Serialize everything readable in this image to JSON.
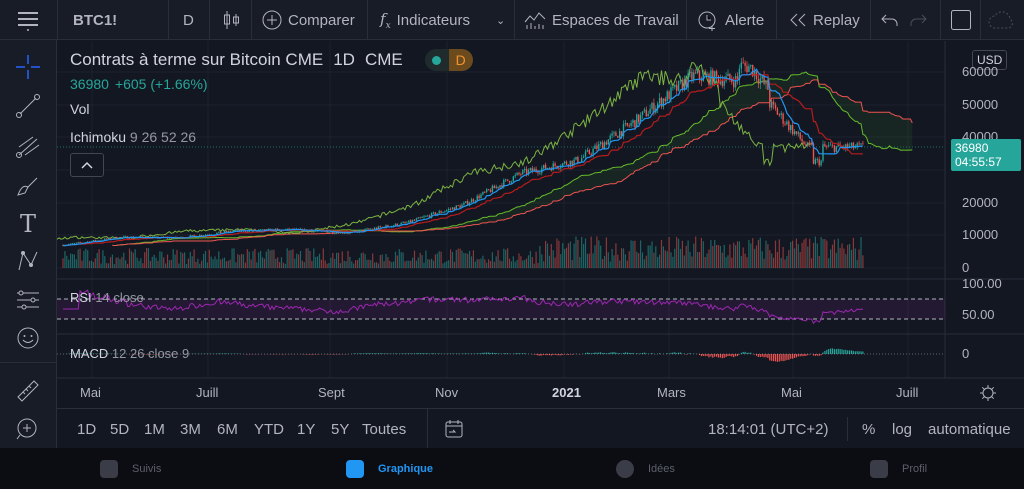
{
  "toolbar": {
    "symbol": "BTC1!",
    "interval": "D",
    "compare": "Comparer",
    "indicators": "Indicateurs",
    "workspaces": "Espaces de Travail",
    "alert": "Alerte",
    "replay": "Replay"
  },
  "legend": {
    "title": "Contrats à terme sur Bitcoin CME",
    "interval": "1D",
    "exchange": "CME",
    "badge": "D",
    "last": "36980",
    "change": "+605 (+1.66%)",
    "vol": "Vol",
    "ichimoku": "Ichimoku",
    "ichimoku_params": "9 26 52 26"
  },
  "rsi": {
    "label": "RSI",
    "params": "14 close",
    "axis": [
      "100.00",
      "50.00"
    ]
  },
  "macd": {
    "label": "MACD",
    "params": "12 26 close 9",
    "axis": [
      "0"
    ]
  },
  "price_axis": {
    "currency": "USD",
    "ticks": [
      "60000",
      "50000",
      "40000",
      "30000",
      "20000",
      "10000",
      "0"
    ],
    "last_price": "36980",
    "countdown": "04:55:57"
  },
  "time_axis": [
    "Mai",
    "Juill",
    "Sept",
    "Nov",
    "2021",
    "Mars",
    "Mai",
    "Juill"
  ],
  "ranges": [
    "1D",
    "5D",
    "1M",
    "3M",
    "6M",
    "YTD",
    "1Y",
    "5Y",
    "Toutes"
  ],
  "status": {
    "clock": "18:14:01 (UTC+2)",
    "percent": "%",
    "log": "log",
    "auto": "automatique"
  },
  "nav": [
    {
      "label": "Suivis"
    },
    {
      "label": "Graphique",
      "active": true
    },
    {
      "label": "Idées"
    },
    {
      "label": "Profil"
    }
  ],
  "colors": {
    "up": "#26a69a",
    "down": "#ef5350",
    "accent": "#2962ff",
    "tenkan": "#2196f3",
    "kijun": "#b71c1c",
    "spanA": "#66bb2a",
    "spanB": "#ef5350",
    "rsi": "#9c27b0",
    "badge": "#e0891e"
  },
  "chart_data": {
    "type": "candlestick",
    "approx_monthly_close": {
      "2020-04": 7000,
      "2020-05": 9400,
      "2020-06": 9200,
      "2020-07": 11300,
      "2020-08": 11700,
      "2020-09": 10800,
      "2020-10": 13800,
      "2020-11": 19400,
      "2020-12": 29000,
      "2021-01": 33000,
      "2021-02": 45000,
      "2021-03": 58800,
      "2021-04": 57000,
      "2021-05": 37000,
      "2021-06": 36980
    },
    "ylim": [
      0,
      62000
    ]
  }
}
